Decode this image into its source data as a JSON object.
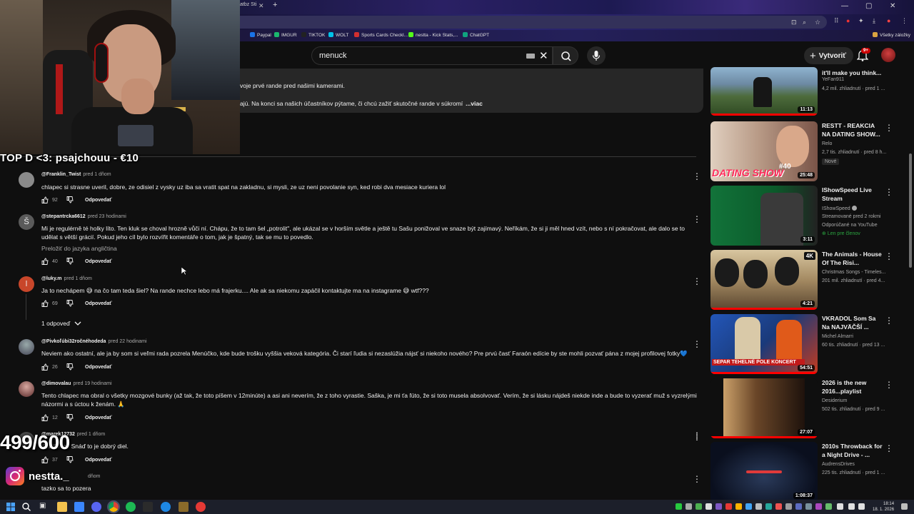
{
  "browser": {
    "tab_title": "atbz Sti",
    "bookmarks": [
      {
        "label": "Paypal",
        "color": "#1a73e8"
      },
      {
        "label": "IMGUR",
        "color": "#1bb76e"
      },
      {
        "label": "TIKTOK",
        "color": "#222222"
      },
      {
        "label": "WOLT",
        "color": "#00c2e8"
      },
      {
        "label": "Sports Cards Checkl...",
        "color": "#d32f2f"
      },
      {
        "label": "nestta - Kick Stats,...",
        "color": "#53fc18"
      },
      {
        "label": "ChatGPT",
        "color": "#10a37f"
      }
    ],
    "all_bookmarks": "Všetky záložky"
  },
  "yt_header": {
    "search_value": "menuck",
    "create_label": "Vytvoriť",
    "notification_count": "9+"
  },
  "description": {
    "line1": "voje prvé rande pred našimi kamerami.",
    "line2": "ajú. Na konci sa našich účastníkov pýtame, či chcú zažiť skutočné rande v súkromí",
    "more": "...viac"
  },
  "overlay": {
    "top_donation": "TOP D <3: psajchouu - €10",
    "counter": "499/600",
    "instagram": "nestta._"
  },
  "comments": [
    {
      "author": "@Franklin_Twist",
      "when": "pred 1 dňom",
      "text": "chlapec si strasne uveril, dobre, ze odisiel z vysky uz iba sa vratit  spat na zakladnu,  si mysli, ze uz neni povolanie syn, ked robi dva mesiace kuriera lol",
      "likes": "92",
      "reply": "Odpovedať"
    },
    {
      "author": "@stepantrcka6612",
      "when": "pred 23 hodinami",
      "text": "Mi je regulérně té holky líto. Ten kluk se choval hrozně vůči ní. Chápu, že to tam šel „potrolit\", ale ukázal se v horším světle a ještě tu Sašu ponižoval ve snaze být zajímavý. Neříkám, že si ji měl hned vzít, nebo s ní pokračovat, ale dalo se to udělat s větší grácií. Pokud jeho cíl bylo rozvířit komentáře o tom, jak je špatný, tak se mu to povedlo.",
      "translate": "Preložiť do jazyka angličtina",
      "likes": "40",
      "reply": "Odpovedať"
    },
    {
      "author": "@luky.m",
      "when": "pred 1 dňom",
      "text": "Ja to nechápem 😅 na čo tam teda šiel? Na rande nechce lebo má frajerku.... Ale ak sa niekomu zapáčil kontaktujte ma na instagrame 😅 wtf???",
      "likes": "69",
      "reply": "Odpovedať",
      "replies": "1 odpoveď"
    },
    {
      "author": "@Pivkoľúbi32ročnéhodeda",
      "when": "pred 22 hodinami",
      "text": "Neviem ako ostatní, ale ja by som si veľmi rada pozrela Menúčko, kde bude trošku vyššia veková kategória. Či starí ľudia si nezaslúžia nájsť si niekoho nového? Pre prvú časť Faraón edície by ste mohli pozvať pána z mojej profilovej fotky💙",
      "likes": "26",
      "reply": "Odpovedať"
    },
    {
      "author": "@dimovalau",
      "when": "pred 19 hodinami",
      "text": "Tento chlapec ma obral o všetky mozgové bunky (až tak, že toto píšem v 12minúte) a asi ani neverím, že z toho vyrastie. Saška, je mi ťa ľúto, že si toto musela absolvovať. Verím, že si lásku nájdeš niekde inde a bude to vyzerať muž s vyzrelými názormi a s úctou k ženám. 🙏",
      "likes": "12",
      "reply": "Odpovedať"
    },
    {
      "author": "@marek12732",
      "when": "pred 1 dňom",
      "text": "Stačilo mi. Snáď to je dobrý diel.",
      "likes": "37",
      "reply": "Odpovedať"
    },
    {
      "author": "",
      "when": "dňom",
      "text": "tazko sa to pozera",
      "likes": "",
      "reply": ""
    }
  ],
  "recommendations": [
    {
      "title": "it'll make you think...",
      "channel": "YeFan911",
      "meta": "4,2 mil. zhliadnutí · pred 1 ...",
      "duration": "11:13",
      "thumb": [
        "#7e9fb8",
        "#4a6a3a"
      ]
    },
    {
      "title": "RESTT - REAKCIA NA DATING SHOW...",
      "channel": "Relo",
      "meta": "2,7 tis. zhliadnutí · pred 8 h...",
      "badge": "Nové",
      "duration": "25:48",
      "thumb": [
        "#c9b3a0",
        "#6a3a2a"
      ],
      "overlay_text": "DATING SHOW",
      "overlay_num": "#40"
    },
    {
      "title": "IShowSpeed Live Stream",
      "channel": "IShowSpeed",
      "meta": "Streamované pred 2 rokmi",
      "meta2": "Odporúčané na YouTube",
      "member": "Len pre členov",
      "duration": "3:11",
      "thumb": [
        "#0e4a22",
        "#1a1a1a"
      ]
    },
    {
      "title": "The Animals - House Of The Risi...",
      "channel": "Christmas Songs - Timeles...",
      "meta": "201 mil. zhliadnutí · pred 4...",
      "duration": "4:21",
      "badge4k": "4K",
      "thumb": [
        "#c9b58e",
        "#4a3a2a"
      ]
    },
    {
      "title": "VKRADOL Som Sa Na NAJVÄČŠÍ ...",
      "channel": "Michel Almarri",
      "meta": "60 tis. zhliadnutí · pred 13 ...",
      "duration": "54:51",
      "overlay_text": "SEPAR TEHELNÉ POLE KONCERT",
      "thumb": [
        "#1a3a7a",
        "#d04020"
      ]
    },
    {
      "title": "2026 is the new 2016...playlist",
      "channel": "Desiderium",
      "meta": "502 tis. zhliadnutí · pred 9 ...",
      "duration": "27:07",
      "thumb": [
        "#8a6a3a",
        "#2a1a12"
      ]
    },
    {
      "title": "2010s Throwback for a Night Drive - ...",
      "channel": "AudrensDrives",
      "meta": "225 tis. zhliadnutí · pred 1 ...",
      "duration": "1:08:37",
      "thumb": [
        "#0a0f1e",
        "#1a2a4a"
      ]
    }
  ],
  "taskbar": {
    "time": "18:14",
    "date": "18. 1. 2026"
  }
}
